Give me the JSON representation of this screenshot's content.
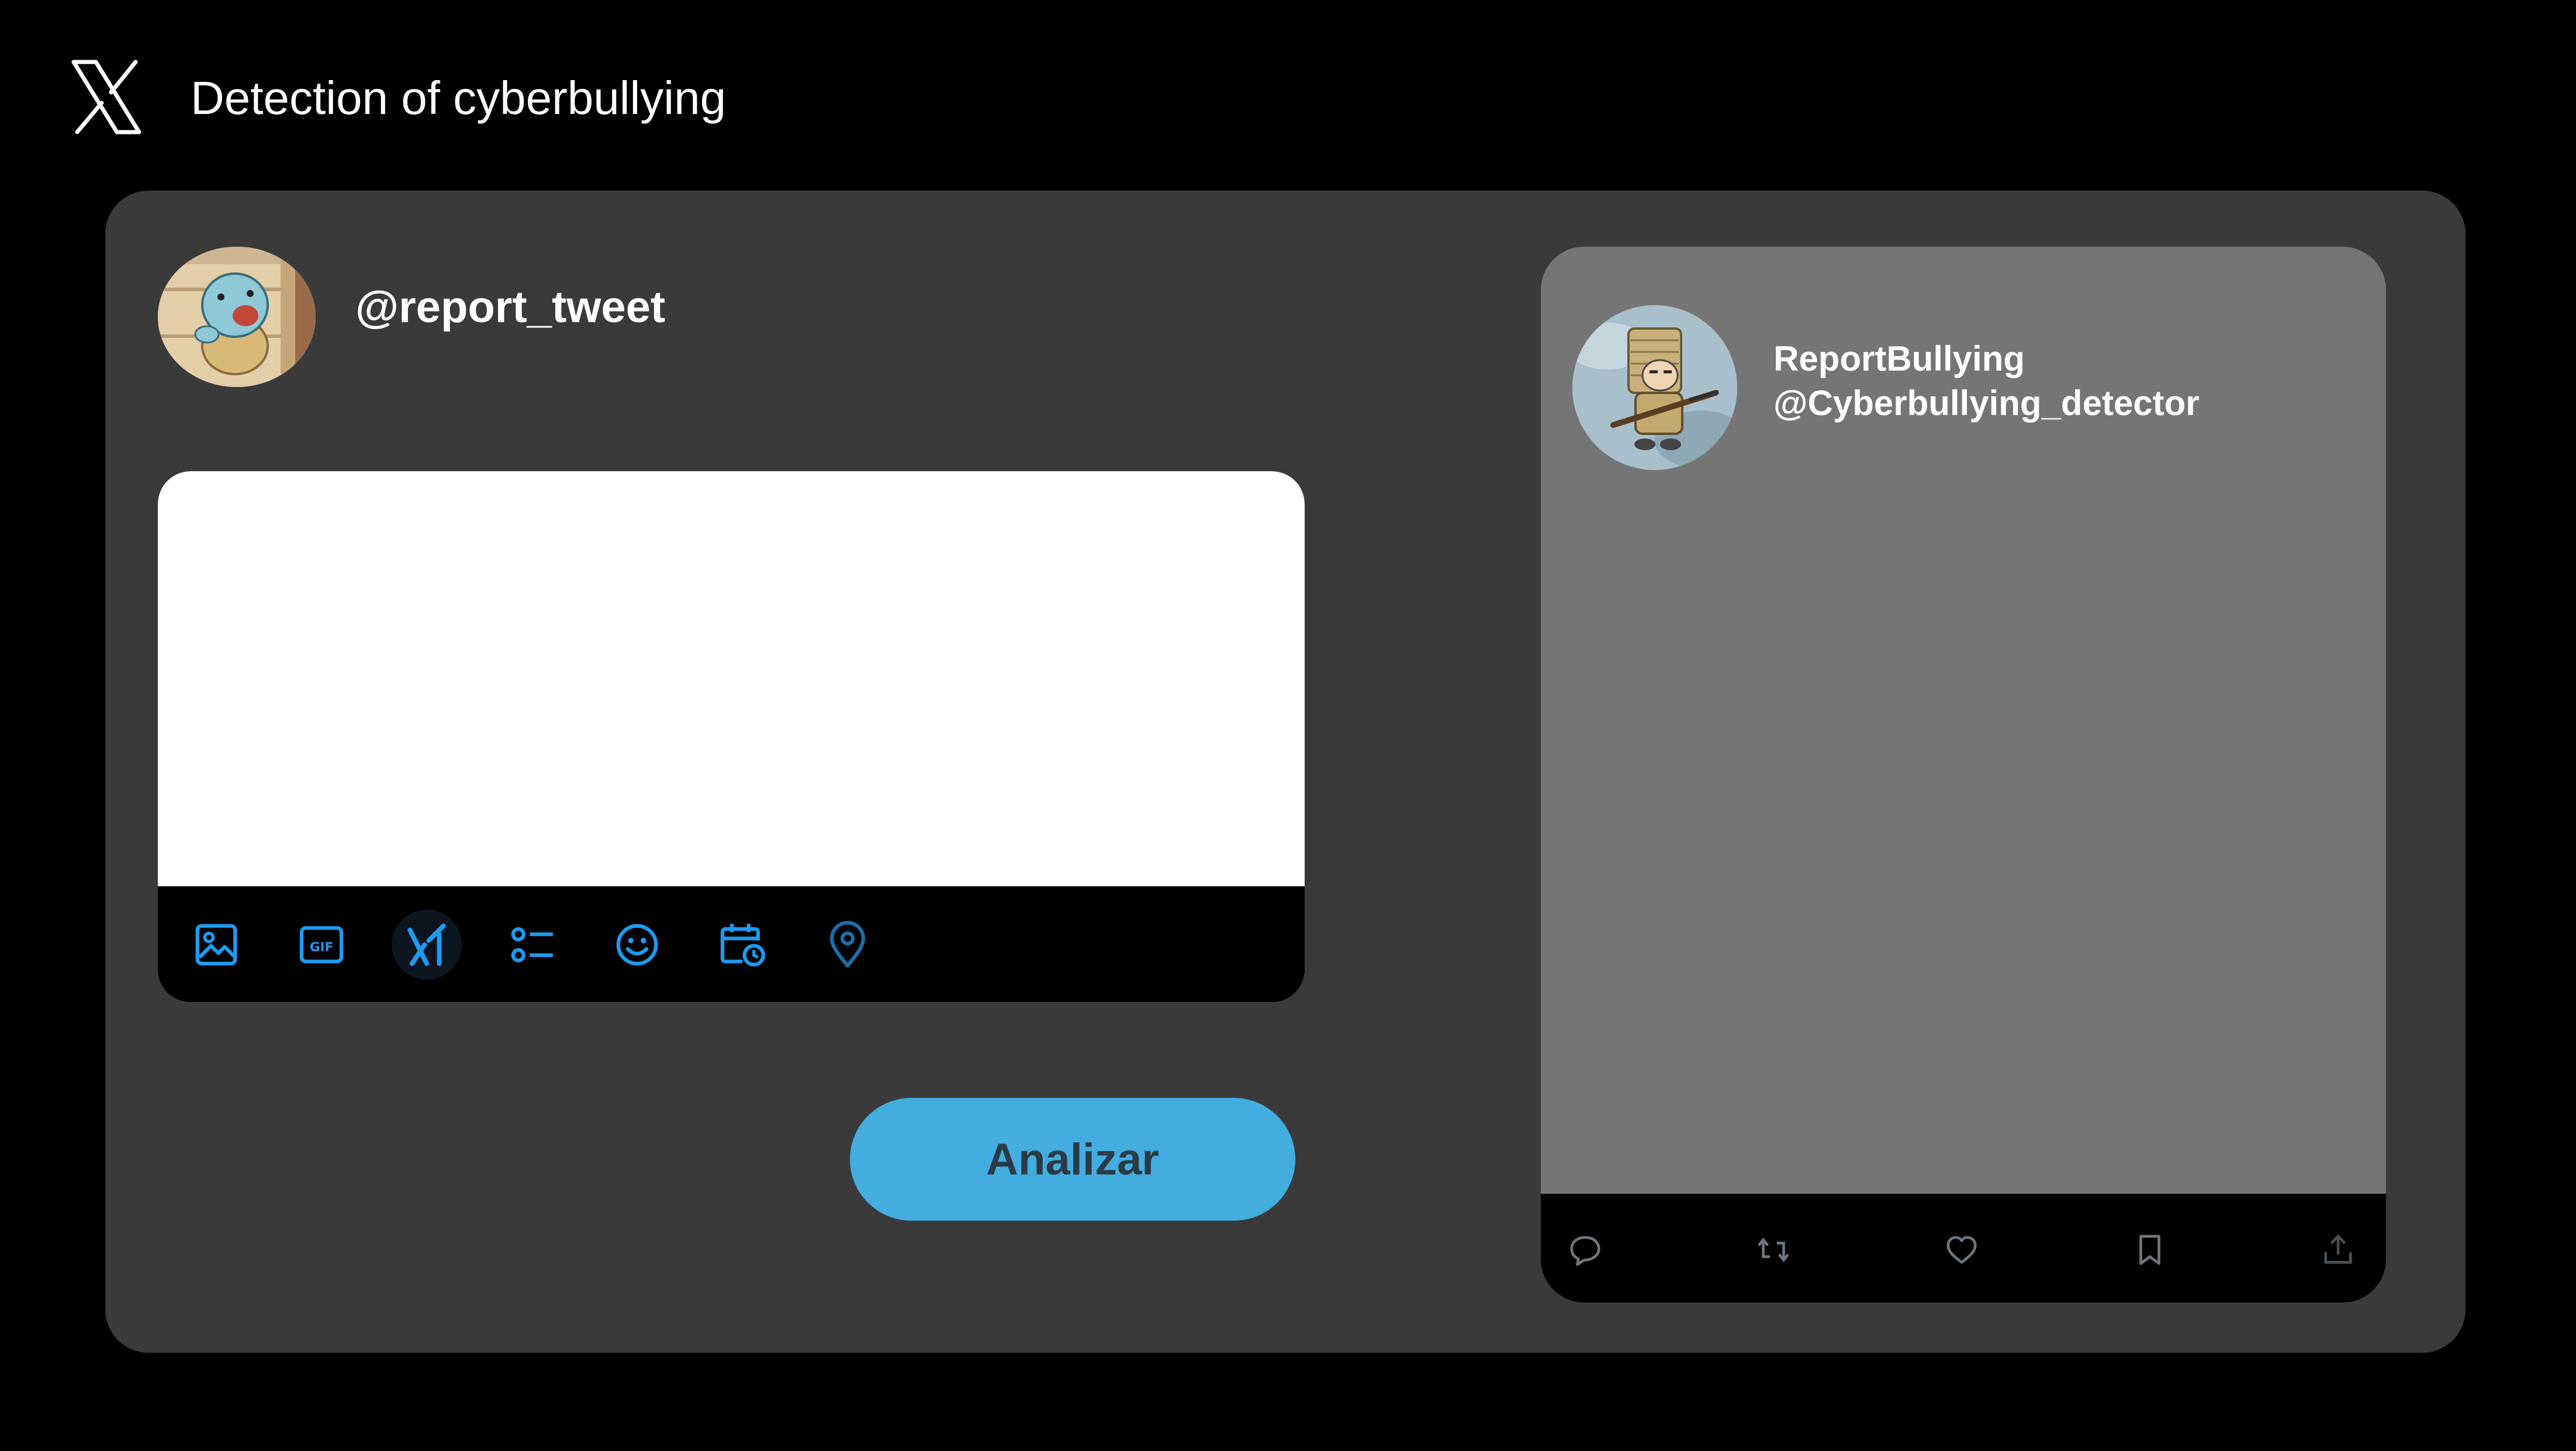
{
  "app": {
    "title": "Detection of cyberbullying",
    "logo_icon": "x-logo-icon"
  },
  "composer": {
    "handle": "@report_tweet",
    "avatar_icon": "squirtle-avatar",
    "text_value": "",
    "placeholder": "",
    "toolbar": [
      {
        "icon": "image-icon"
      },
      {
        "icon": "gif-icon"
      },
      {
        "icon": "grok-icon"
      },
      {
        "icon": "poll-icon"
      },
      {
        "icon": "emoji-icon"
      },
      {
        "icon": "schedule-icon"
      },
      {
        "icon": "location-icon"
      }
    ],
    "analyze_label": "Analizar"
  },
  "output": {
    "display_name": "ReportBullying",
    "handle": "@Cyberbullying_detector",
    "avatar_icon": "soldier-avatar",
    "body": "",
    "actions": [
      {
        "icon": "reply-icon"
      },
      {
        "icon": "retweet-icon"
      },
      {
        "icon": "like-icon"
      },
      {
        "icon": "bookmark-icon"
      },
      {
        "icon": "share-icon"
      }
    ]
  },
  "colors": {
    "background": "#000000",
    "panel": "#3a3a3a",
    "card": "#757575",
    "accent": "#43ade0",
    "toolbar_icon": "#1d9bf0"
  }
}
